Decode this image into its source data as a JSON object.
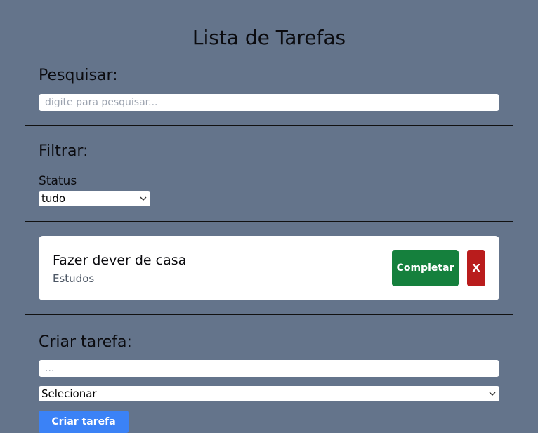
{
  "page": {
    "title": "Lista de Tarefas"
  },
  "search": {
    "heading": "Pesquisar:",
    "placeholder": "digite para pesquisar...",
    "value": ""
  },
  "filter": {
    "heading": "Filtrar:",
    "status_label": "Status",
    "status_selected": "tudo"
  },
  "tasks": [
    {
      "title": "Fazer dever de casa",
      "category": "Estudos",
      "complete_label": "Completar",
      "delete_label": "X"
    }
  ],
  "create": {
    "heading": "Criar tarefa:",
    "placeholder": "...",
    "value": "",
    "category_selected": "Selecionar",
    "submit_label": "Criar tarefa"
  },
  "colors": {
    "background": "#64748b",
    "complete": "#15803d",
    "delete": "#b91c1c",
    "create": "#3b82f6"
  }
}
